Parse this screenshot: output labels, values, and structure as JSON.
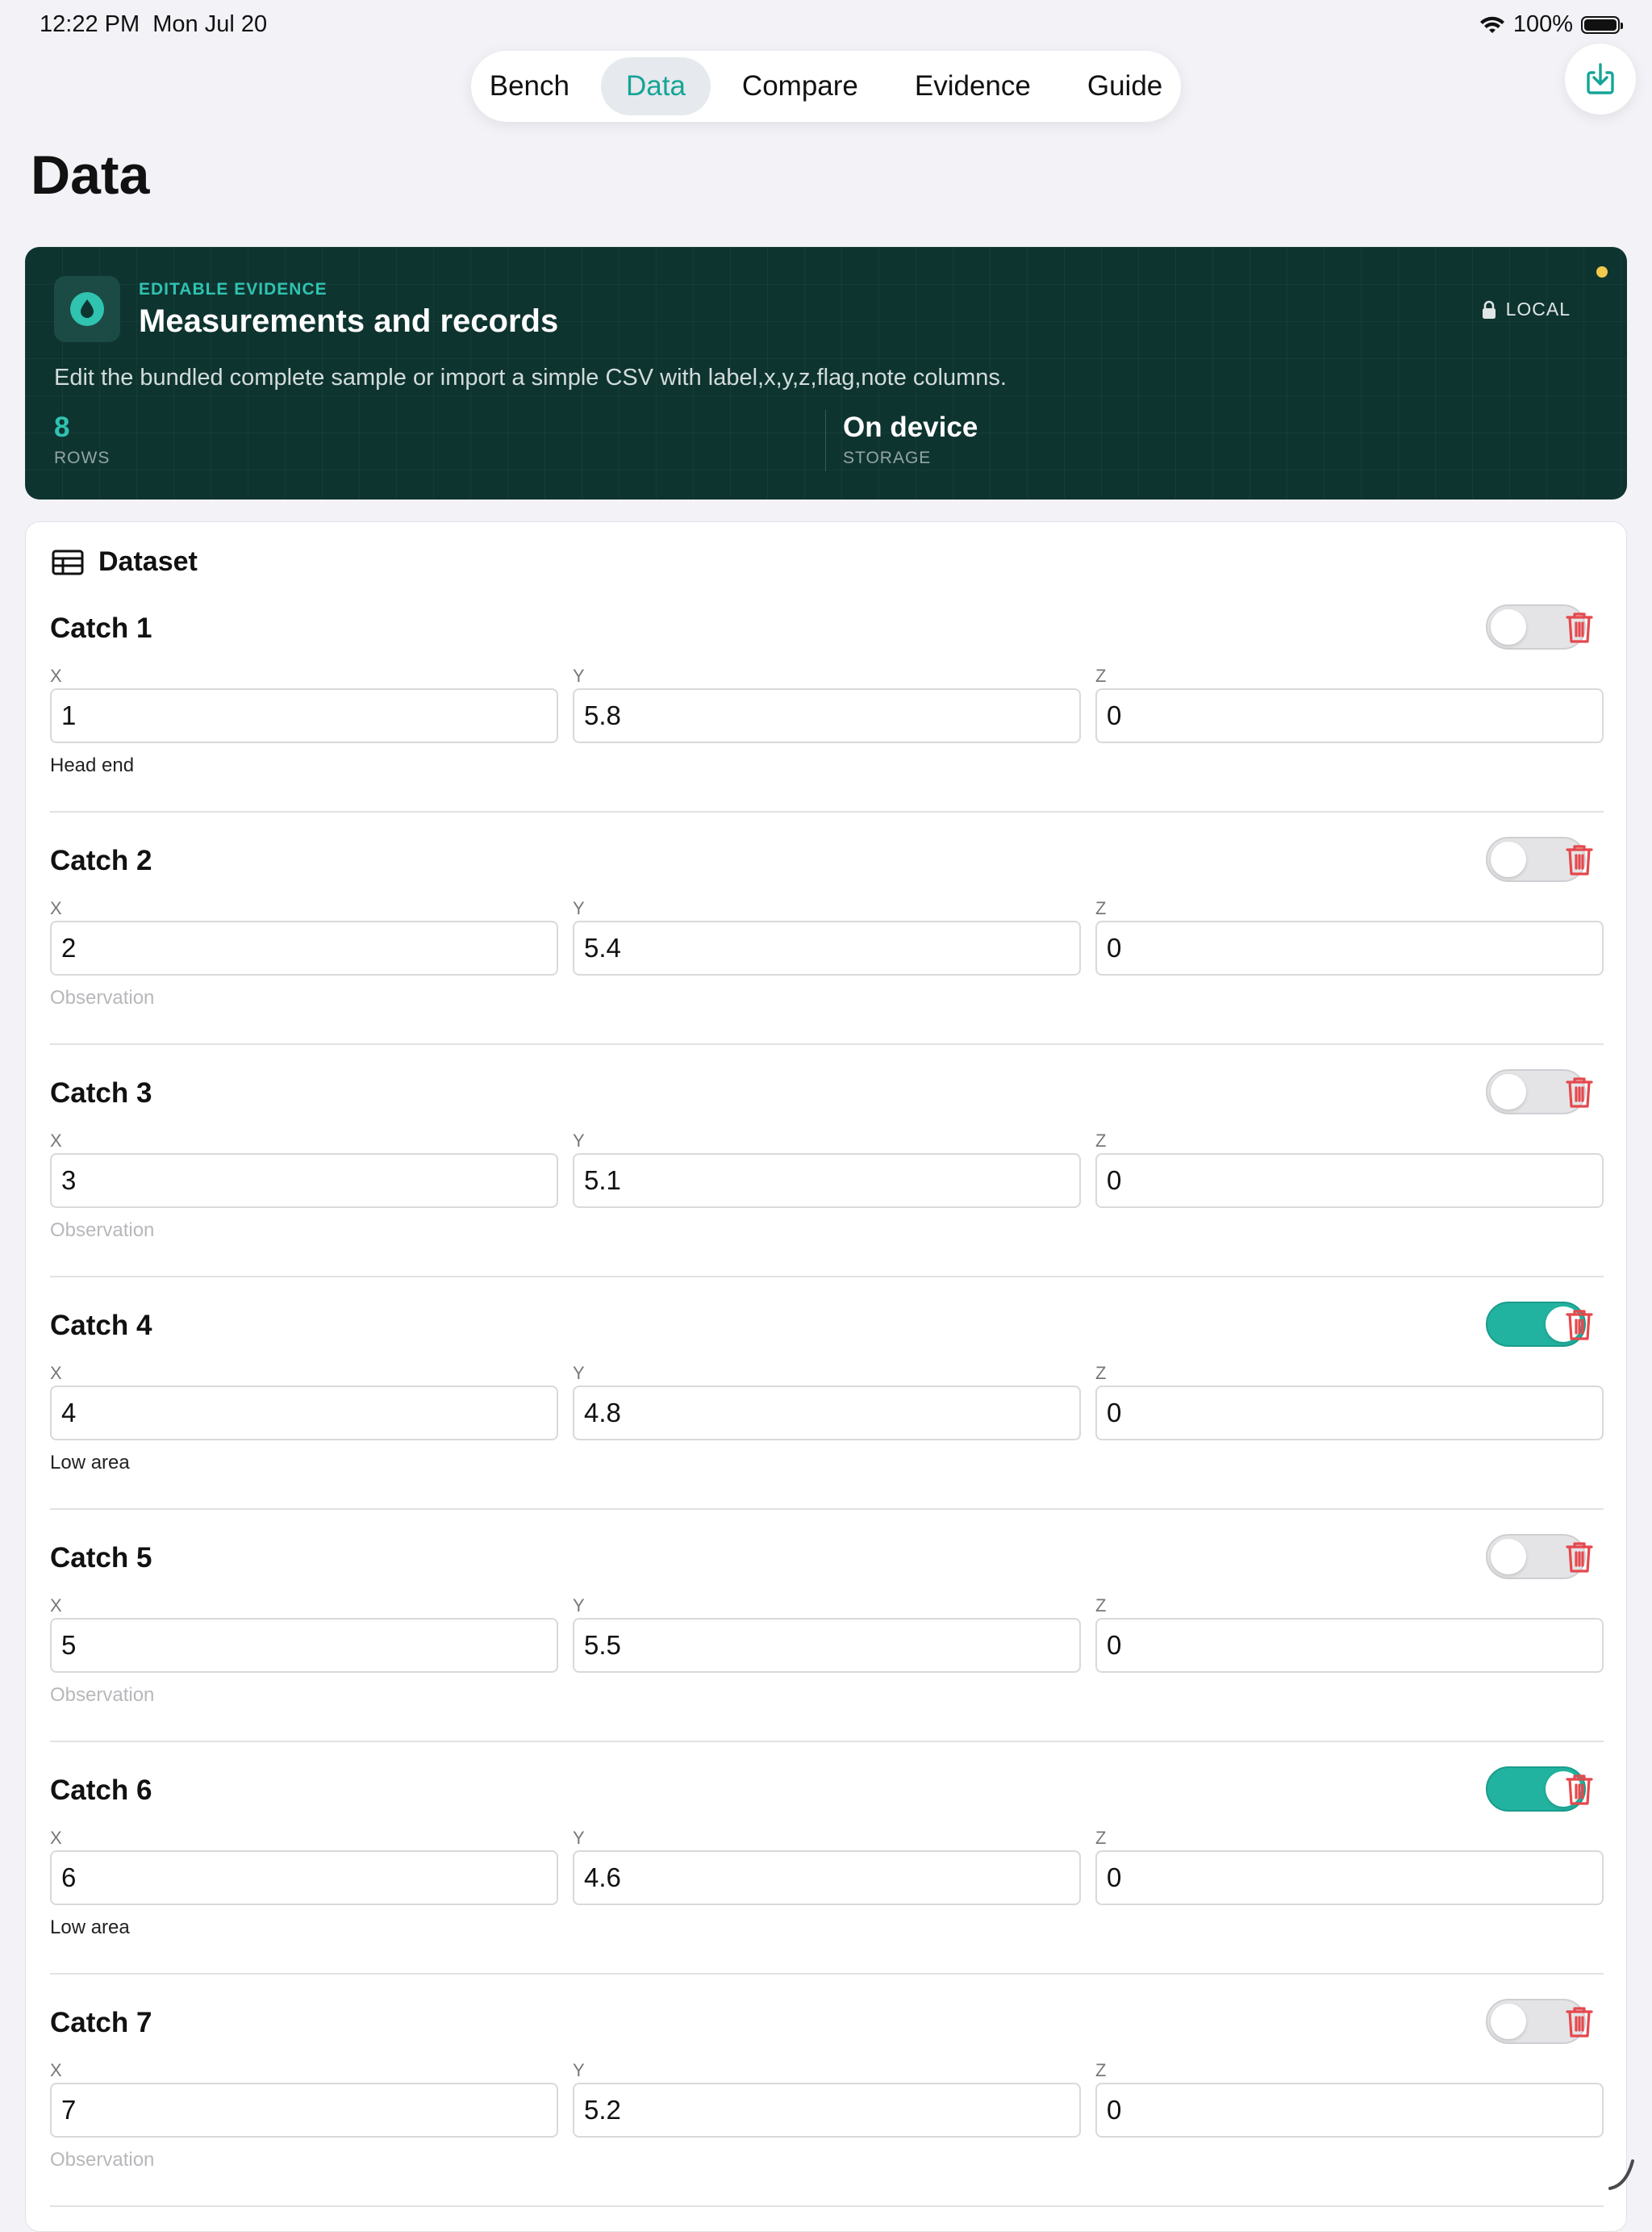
{
  "status": {
    "time": "12:22 PM",
    "date": "Mon Jul 20",
    "battery": "100%",
    "battery_level": 1.0
  },
  "tabs": [
    {
      "label": "Bench",
      "active": false
    },
    {
      "label": "Data",
      "active": true
    },
    {
      "label": "Compare",
      "active": false
    },
    {
      "label": "Evidence",
      "active": false
    },
    {
      "label": "Guide",
      "active": false
    }
  ],
  "icons": {
    "export": "export-download-icon",
    "hero": "water-drop-icon",
    "badge": "lock-icon",
    "dataset": "table-icon",
    "delete": "trash-icon"
  },
  "colors": {
    "accent": "#15a596",
    "hero_bg": "#0e3430",
    "delete": "#e5484d",
    "toggle_on": "#22b3a0"
  },
  "page_title": "Data",
  "hero": {
    "kicker": "EDITABLE EVIDENCE",
    "title": "Measurements and records",
    "badge": "LOCAL",
    "description": "Edit the bundled complete sample or import a simple CSV with label,x,y,z,flag,note columns.",
    "stats": [
      {
        "value": "8",
        "label": "ROWS"
      },
      {
        "value": "On device",
        "label": "STORAGE"
      }
    ]
  },
  "dataset": {
    "title": "Dataset",
    "labels": {
      "x": "X",
      "y": "Y",
      "z": "Z"
    },
    "note_placeholder": "Observation",
    "rows": [
      {
        "label": "Catch 1",
        "x": "1",
        "y": "5.8",
        "z": "0",
        "flag": false,
        "note": "Head end"
      },
      {
        "label": "Catch 2",
        "x": "2",
        "y": "5.4",
        "z": "0",
        "flag": false,
        "note": ""
      },
      {
        "label": "Catch 3",
        "x": "3",
        "y": "5.1",
        "z": "0",
        "flag": false,
        "note": ""
      },
      {
        "label": "Catch 4",
        "x": "4",
        "y": "4.8",
        "z": "0",
        "flag": true,
        "note": "Low area"
      },
      {
        "label": "Catch 5",
        "x": "5",
        "y": "5.5",
        "z": "0",
        "flag": false,
        "note": ""
      },
      {
        "label": "Catch 6",
        "x": "6",
        "y": "4.6",
        "z": "0",
        "flag": true,
        "note": "Low area"
      },
      {
        "label": "Catch 7",
        "x": "7",
        "y": "5.2",
        "z": "0",
        "flag": false,
        "note": ""
      }
    ]
  }
}
